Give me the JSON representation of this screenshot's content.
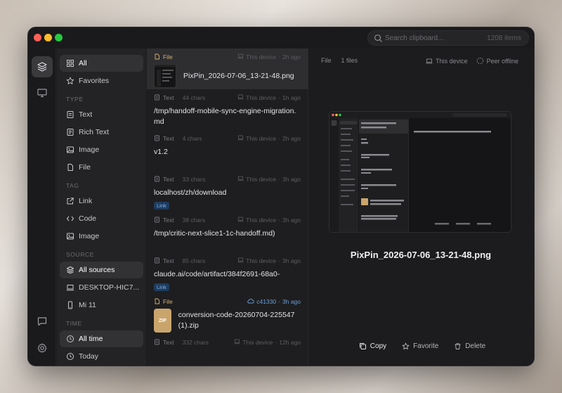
{
  "search": {
    "placeholder": "Search clipboard...",
    "count": "1208 items"
  },
  "sidebar": {
    "top": [
      {
        "label": "All",
        "icon": "grid-icon",
        "active": true
      },
      {
        "label": "Favorites",
        "icon": "star-icon"
      }
    ],
    "sections": [
      {
        "heading": "TYPE",
        "items": [
          {
            "label": "Text",
            "icon": "text-doc-icon"
          },
          {
            "label": "Rich Text",
            "icon": "rich-text-icon"
          },
          {
            "label": "Image",
            "icon": "image-icon"
          },
          {
            "label": "File",
            "icon": "file-icon"
          }
        ]
      },
      {
        "heading": "TAG",
        "items": [
          {
            "label": "Link",
            "icon": "external-link-icon"
          },
          {
            "label": "Code",
            "icon": "code-icon"
          },
          {
            "label": "Image",
            "icon": "image-icon"
          }
        ]
      },
      {
        "heading": "SOURCE",
        "items": [
          {
            "label": "All sources",
            "icon": "layers-icon",
            "active": true
          },
          {
            "label": "DESKTOP-HIC7...",
            "icon": "laptop-icon"
          },
          {
            "label": "Mi 11",
            "icon": "phone-icon"
          }
        ]
      },
      {
        "heading": "TIME",
        "items": [
          {
            "label": "All time",
            "icon": "clock-icon",
            "active": true
          },
          {
            "label": "Today",
            "icon": "clock-icon"
          }
        ]
      }
    ]
  },
  "list": [
    {
      "kind": "File",
      "chars": "",
      "source": "This device",
      "time": "2h ago",
      "text": "PixPin_2026-07-06_13-21-48.png",
      "thumb": "image",
      "selected": true
    },
    {
      "kind": "Text",
      "chars": "44 chars",
      "source": "This device",
      "time": "1h ago",
      "text": "/tmp/handoff-mobile-sync-engine-migration.md"
    },
    {
      "kind": "Text",
      "chars": "4 chars",
      "source": "This device",
      "time": "2h ago",
      "text": "v1.2"
    },
    {
      "kind": "Text",
      "chars": "33 chars",
      "source": "This device",
      "time": "3h ago",
      "text": "localhost/zh/download",
      "tag": "Link"
    },
    {
      "kind": "Text",
      "chars": "38 chars",
      "source": "This device",
      "time": "3h ago",
      "text": "/tmp/critic-next-slice1-1c-handoff.md)"
    },
    {
      "kind": "Text",
      "chars": "85 chars",
      "source": "This device",
      "time": "3h ago",
      "text": "claude.ai/code/artifact/384f2691-68a0-",
      "tag": "Link"
    },
    {
      "kind": "File",
      "chars": "",
      "source": "c41330",
      "time": "3h ago",
      "text": "conversion-code-20260704-225547 (1).zip",
      "thumb": "zip",
      "cloud": true
    },
    {
      "kind": "Text",
      "chars": "332 chars",
      "source": "This device",
      "time": "12h ago",
      "text": ""
    }
  ],
  "detail": {
    "kind": "File",
    "count": "1 files",
    "device": "This device",
    "peer": "Peer offline",
    "title": "PixPin_2026-07-06_13-21-48.png",
    "actions": {
      "copy": "Copy",
      "favorite": "Favorite",
      "delete": "Delete"
    }
  },
  "colors": {
    "accent_file": "#d4b06a",
    "tag_bg": "#1f3b5e",
    "tag_fg": "#7fb2ee",
    "zip": "#c9a56b"
  }
}
